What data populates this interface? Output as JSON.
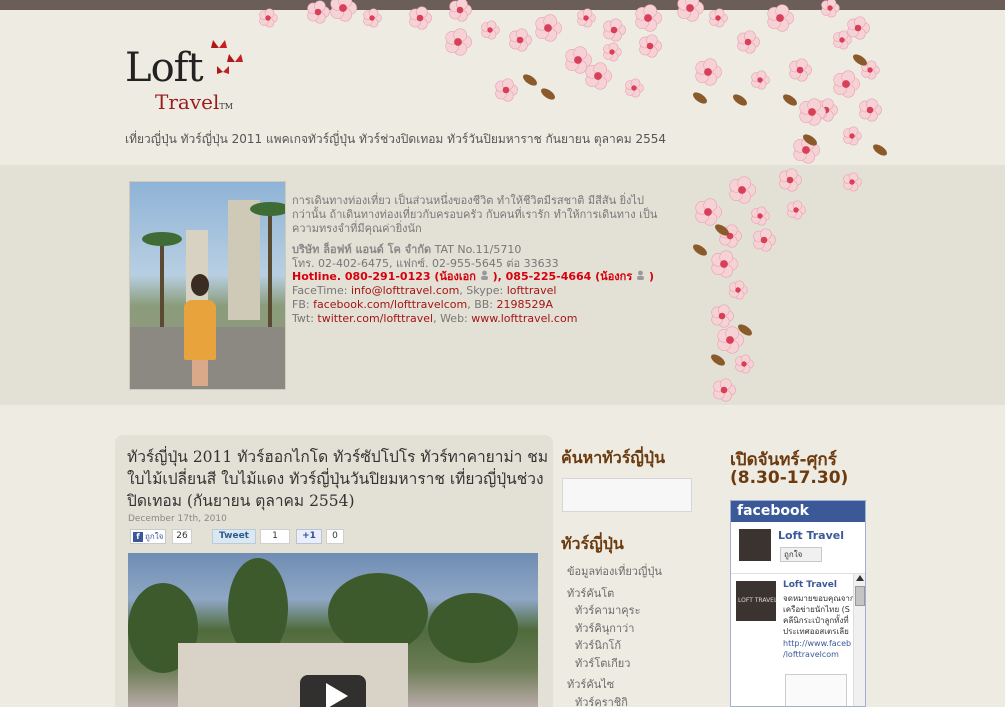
{
  "header": {
    "logo_loft": "Loft",
    "logo_travel": "Travel",
    "logo_tm": "TM",
    "tagline": "เที่ยวญี่ปุ่น ทัวร์ญี่ปุ่น 2011 แพคเกจทัวร์ญี่ปุ่น ทัวร์ช่วงปิดเทอม ทัวร์วันปิยมหาราช กันยายน ตุลาคม 2554"
  },
  "profile": {
    "intro": "การเดินทางท่องเที่ยว เป็นส่วนหนึ่งของชีวิต ทำให้ชีวิตมีรสชาติ มีสีสัน ยิ่งไปกว่านั้น ถ้าเดินทางท่องเที่ยวกับครอบครัว กับคนที่เรารัก ทำให้การเดินทาง เป็นความทรงจำที่มีคุณค่ายิ่งนัก",
    "company": "บริษัท ล็อฟท์ แอนด์ โค จำกัด",
    "tat": "TAT No.11/5710",
    "phone_line": "โทร. 02-402-6475, แฟกซ์. 02-955-5645 ต่อ 33633",
    "hotline_label": "Hotline. 080-291-0123 (น้องเอก",
    "hotline_mid": "), 085-225-4664 (น้องกร",
    "hotline_end": ")",
    "facetime_label": "FaceTime: ",
    "facetime_value": "info@lofttravel.com",
    "skype_label": ", Skype: ",
    "skype_value": "lofttravel",
    "fb_label": "FB: ",
    "fb_value": "facebook.com/lofttravelcom",
    "bb_label": ", BB: ",
    "bb_value": "2198529A",
    "twt_label": "Twt: ",
    "twt_value": "twitter.com/lofttravel",
    "web_label": ", Web: ",
    "web_value": "www.lofttravel.com"
  },
  "post": {
    "title": "ทัวร์ญี่ปุ่น 2011 ทัวร์ฮอกไกโด ทัวร์ซัปโปโร ทัวร์ทาคายาม่า ชมใบไม้เปลี่ยนสี ใบไม้แดง ทัวร์ญี่ปุ่นวันปิยมหาราช เที่ยวญี่ปุ่นช่วงปิดเทอม (กันยายน ตุลาคม 2554)",
    "date": "December 17th, 2010",
    "like_label": "ถูกใจ",
    "like_count": "26",
    "tweet_label": "Tweet",
    "tweet_count": "1",
    "gplus_label": "+1",
    "gplus_count": "0"
  },
  "sidebar": {
    "search_title": "ค้นหาทัวร์ญี่ปุ่น",
    "categories_title": "ทัวร์ญี่ปุ่น",
    "categories": [
      {
        "label": "ข้อมูลท่องเที่ยวญี่ปุ่น",
        "level": 0
      },
      {
        "label": "ทัวร์คันโต",
        "level": 0
      },
      {
        "label": "ทัวร์คามาคุระ",
        "level": 1
      },
      {
        "label": "ทัวร์คินุกาว่า",
        "level": 1
      },
      {
        "label": "ทัวร์นิกโก้",
        "level": 1
      },
      {
        "label": "ทัวร์โตเกียว",
        "level": 1
      },
      {
        "label": "ทัวร์คันไซ",
        "level": 0
      },
      {
        "label": "ทัวร์คุราชิกิ",
        "level": 1
      }
    ]
  },
  "rightcol": {
    "hours_line1": "เปิดจันทร์-ศุกร์",
    "hours_line2": "(8.30-17.30)",
    "fb_header": "facebook",
    "fb_page_name": "Loft Travel",
    "fb_like_btn": "ถูกใจ",
    "fb_feed_name": "Loft Travel",
    "fb_feed_text": "จดหมายขอบคุณจาก เครือข่ายนักไทย (S คลีนิกระเป๋าลูกทั้งที่ ประเทศออสเตรเลีย",
    "fb_feed_link": "http://www.faceb /lofttravelcom",
    "fb_thumb_text": "LOFT TRAVEL"
  },
  "colors": {
    "background": "#eeebe3",
    "band": "#e3e1d6",
    "topbar": "#6b5d57",
    "section_title": "#6b3a0e",
    "hotline": "#d8000c",
    "link": "#a31515",
    "facebook": "#3b5998"
  }
}
